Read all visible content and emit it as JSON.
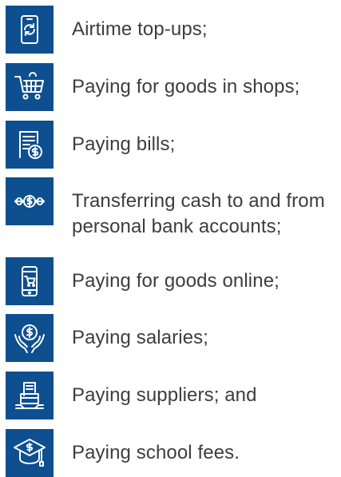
{
  "items": [
    {
      "icon": "mobile-refresh-icon",
      "label": "Airtime top-ups;"
    },
    {
      "icon": "shopping-cart-icon",
      "label": "Paying for goods in shops;"
    },
    {
      "icon": "bill-dollar-icon",
      "label": "Paying bills;"
    },
    {
      "icon": "cash-transfer-icon",
      "label_line1": "Transferring cash to and from",
      "label_line2": "personal bank accounts;"
    },
    {
      "icon": "mobile-cart-icon",
      "label": "Paying for goods online;"
    },
    {
      "icon": "hands-coin-icon",
      "label": "Paying salaries;"
    },
    {
      "icon": "supplier-box-icon",
      "label": "Paying suppliers; and"
    },
    {
      "icon": "graduation-cap-dollar-icon",
      "label": "Paying school fees."
    }
  ],
  "colors": {
    "icon_bg": "#0e4f8f",
    "icon_fg": "#ffffff",
    "text": "#3d3d3d"
  }
}
